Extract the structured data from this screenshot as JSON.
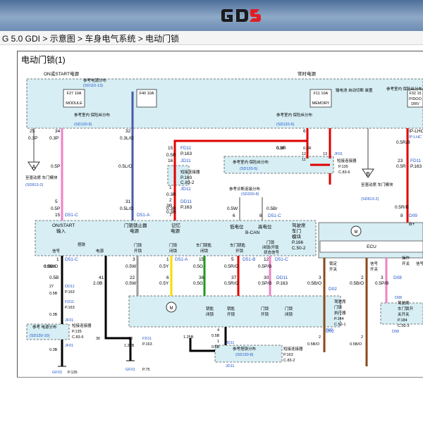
{
  "header": {
    "logo_text": "GDS",
    "logo_color": "#e01e25"
  },
  "breadcrumb": "G 5.0 GDI > 示意图 > 车身电气系统 > 电动门锁",
  "diagram": {
    "title": "电动门锁(1)",
    "power_labels": [
      "ON或START电源",
      "常时电源"
    ],
    "fuses": [
      "F27 10A",
      "MODULE",
      "F40 10A",
      "F11 10A",
      "MEMORY",
      "F32 15",
      "P/DOO",
      "DRV"
    ],
    "memory_note": "输电池 自动切断 装置",
    "power_refs": [
      "参考电源分布",
      "(SD110-13)",
      "参考室内 保险丝分布",
      "(SD120-9)",
      "参考室内 保险丝分布",
      "(SD120-5)"
    ],
    "wire_colors": {
      "pink": "#ee82c5",
      "blue": "#4a5aa8",
      "red": "#e00000",
      "black": "#000000",
      "brown": "#8a4a1a",
      "green": "#1f9a1f",
      "yellow": "#f2de00",
      "orange": "#f08a10",
      "grey": "#888888",
      "ref": "#2255cc",
      "box": "#d6eef4"
    },
    "top_wires": [
      "25",
      "0.3P",
      "34",
      "0.3P",
      "32",
      "0.3L/O",
      "6",
      "0.3R",
      "0.5P",
      "0.5L/O",
      "IP-LHC"
    ],
    "connectors_left": [
      "FD11",
      "P.163",
      "JD11",
      "短接连接器",
      "P.163",
      "C.83-2",
      "JD11",
      "DD11",
      "P.163"
    ],
    "wire_numbers_mid": [
      "15",
      "0.5R",
      "16",
      "1",
      "0.3R",
      "2",
      "3R",
      "31",
      "0.3R",
      "7",
      "0.3R",
      "5",
      "0.5L/O",
      "0.5P",
      "15",
      "D51-C",
      "D51-A"
    ],
    "jf01_block": [
      "0.3R",
      "0.3R",
      "12",
      "11",
      "13",
      "JF01",
      "短接连接器",
      "P.135",
      "C.83-6",
      "参考室内 保险丝分布",
      "(SD120-5)"
    ],
    "right_top": [
      "0.5R/B",
      "23",
      "0.5R",
      "FD11",
      "P.163",
      "0.5R/B",
      "8",
      "D09",
      "B+"
    ],
    "module_refs": [
      "至驱动席 车门模块",
      "(SD813-2)",
      "至驱动席 车门模块",
      "(SD813-2)"
    ],
    "diag_ref": [
      "参考诊断连接分布",
      "(SD200-8)"
    ],
    "can_lines": [
      "0.5W",
      "0.5Br",
      "6",
      "8",
      "D51-C",
      "低电位",
      "高电位",
      "B-CAN"
    ],
    "main_module": {
      "left_labels": [
        "ON/START",
        "输入"
      ],
      "labels": [
        "门锁锁止器",
        "电源",
        "记忆",
        "电源"
      ],
      "right_label": [
        "驾驶席",
        "车门",
        "模块",
        "P.166",
        "C.50-2"
      ],
      "bottom_labels": [
        "搭铁",
        "信号",
        "电源",
        "门锁",
        "开锁",
        "门锁",
        "闭锁",
        "车门钥匙",
        "闭锁",
        "车门钥匙",
        "开锁",
        "门锁",
        "闭锁/开锁",
        "状态信号"
      ]
    },
    "ecu": {
      "label": "ECU",
      "motor": "M",
      "texts": [
        "锁定",
        "开关",
        "信号",
        "开关",
        "开关",
        "操作",
        "信号"
      ]
    },
    "wire_rows": [
      [
        "1",
        "0.5B/O",
        "D51-C",
        "0.5B",
        "41",
        "2.0B"
      ],
      [
        "3",
        "0.5W",
        "1",
        "0.5Y",
        "D51-A",
        "15",
        "0.5G",
        "5",
        "0.5R/O",
        "D51-B",
        "12",
        "0.5P/B",
        "D51-C"
      ],
      [
        "22",
        "0.5W",
        "6",
        "0.5Y",
        "36",
        "0.5G",
        "37",
        "0.5R/O",
        "30",
        "0.5P/B",
        "DD11",
        "P.163"
      ],
      [
        "3",
        "0.5B/O",
        "D02",
        "2",
        "0.5B/O",
        "3",
        "0.5P/B",
        "D08"
      ]
    ],
    "left_column": [
      "0.5B/O",
      "27",
      "DD11",
      "P.163",
      "0.5B",
      "FD11",
      "P.163",
      "0.3B",
      "JF01",
      "短接连接器",
      "P.135",
      "C.83-6",
      "参考 电源分布",
      "(SD130-10)",
      "JF01",
      "0.3B",
      "GF03",
      "P.135"
    ],
    "actuator": {
      "motor": "M",
      "labels": [
        "钥匙",
        "闭锁",
        "钥匙",
        "开锁",
        "门锁",
        "开锁",
        "门锁",
        "闭锁"
      ],
      "right_label": [
        "驾驶席",
        "门锁",
        "执行器",
        "P.164",
        "C.50-1"
      ],
      "connector": "D02"
    },
    "bottom_wires": [
      "36",
      "10",
      "1.25B",
      "FD11",
      "P.163",
      "GF01",
      "P.75",
      "4",
      "0.5B",
      "1",
      "0.5B",
      "1.25B",
      "JD11",
      "参考搭铁分布",
      "(SD130-8)",
      "短接连接器",
      "P.163",
      "C.83-2",
      "JD11",
      "2",
      "0.5B/O",
      "2",
      "0.5B/O",
      "D02"
    ],
    "right_switch": [
      "D08",
      "驾驶席",
      "车门锁开",
      "关开关",
      "P.184",
      "C.50-3",
      "D08"
    ],
    "power_right_labels": [
      "参考室内 保险丝分布",
      "IP-LHC"
    ]
  }
}
